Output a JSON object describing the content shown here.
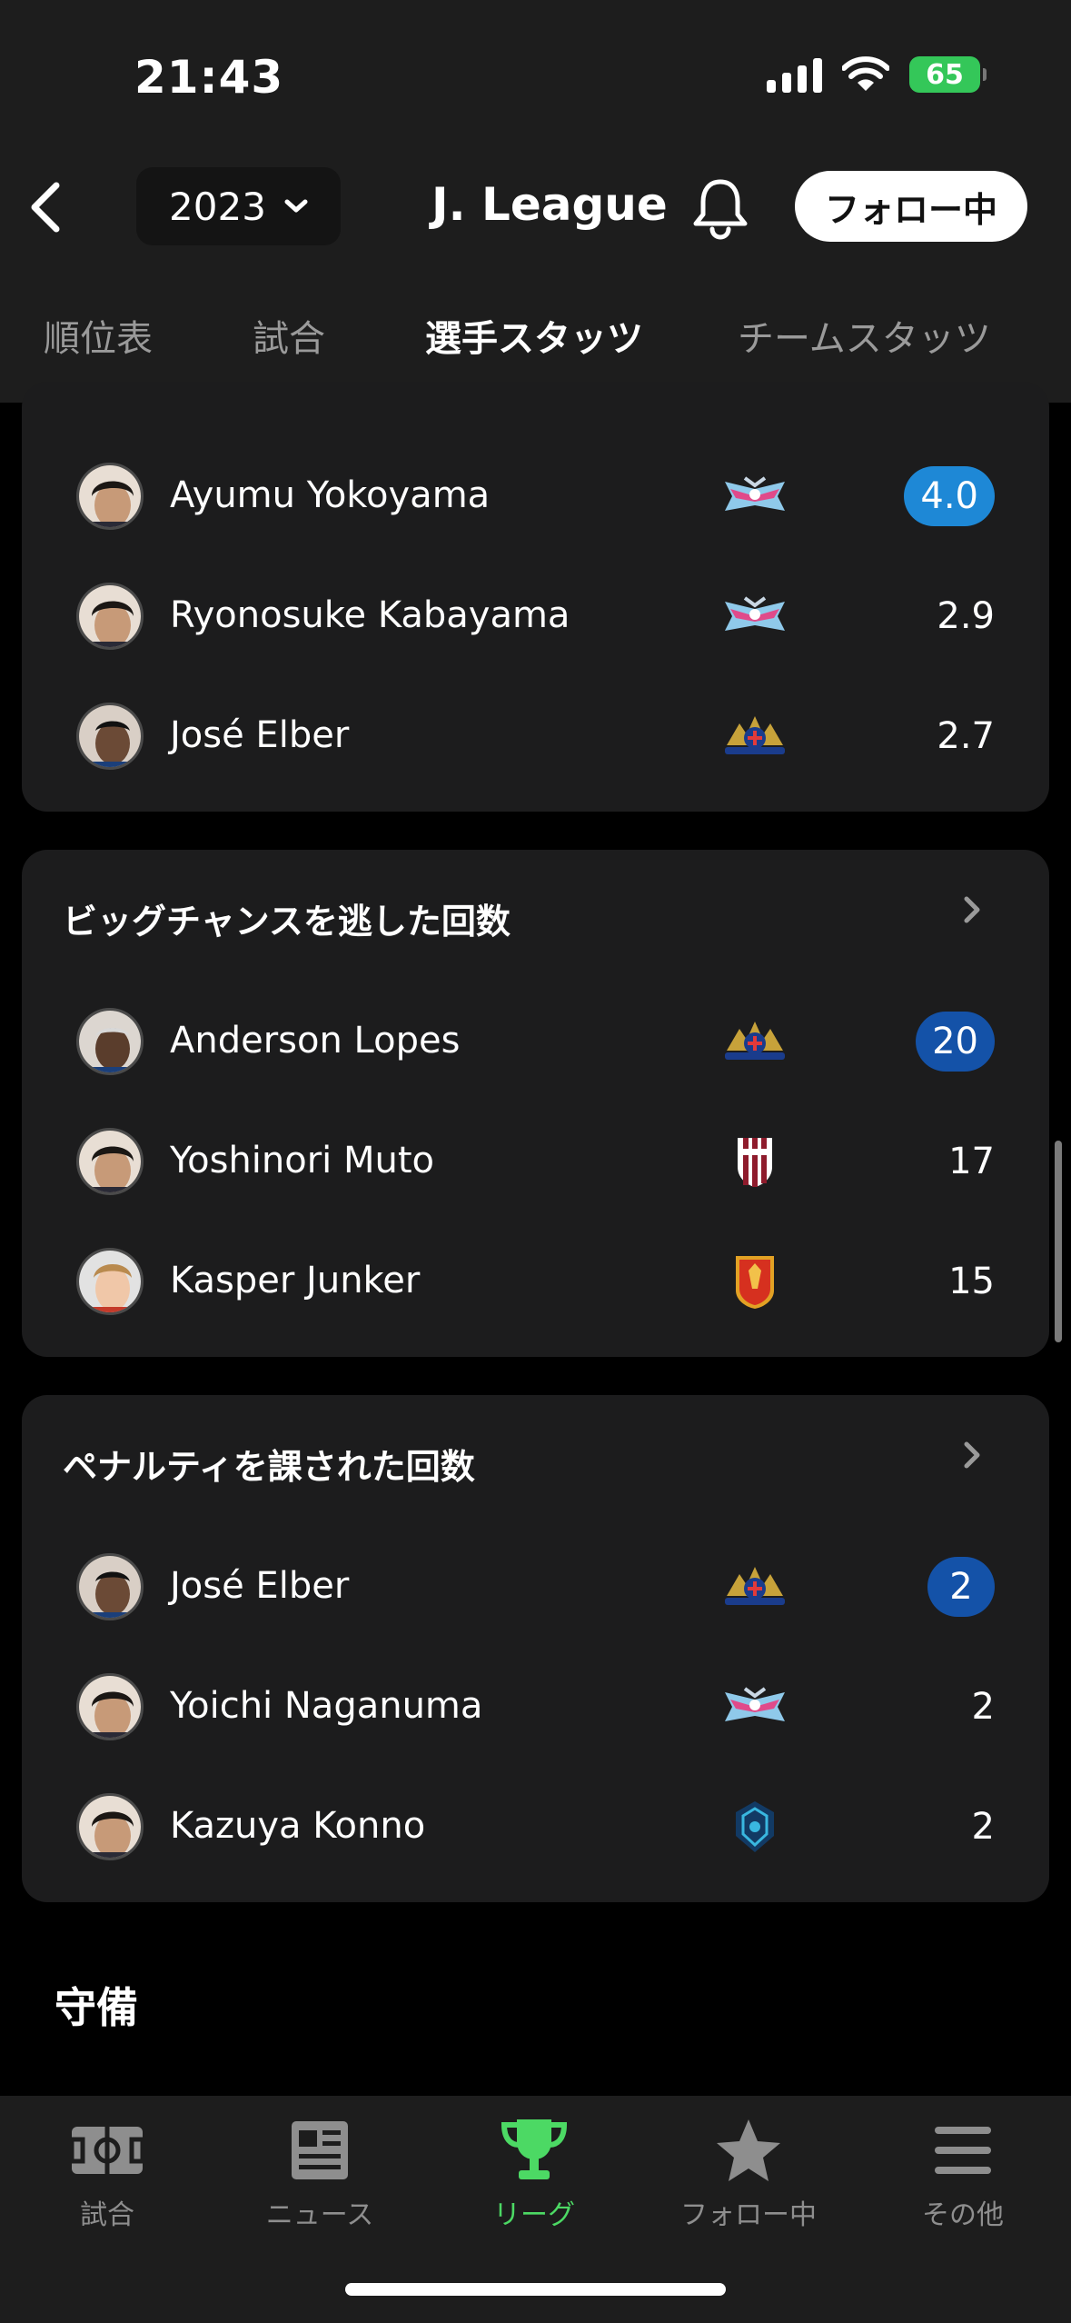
{
  "status_bar": {
    "time": "21:43",
    "battery": "65"
  },
  "header": {
    "year": "2023",
    "title": "J. League",
    "follow_label": "フォロー中"
  },
  "tabs": [
    {
      "label": "順位表"
    },
    {
      "label": "試合"
    },
    {
      "label": "選手スタッツ"
    },
    {
      "label": "チームスタッツ"
    }
  ],
  "accent_color": "#4cd964",
  "cards": [
    {
      "title": "",
      "rows": [
        {
          "name": "Ayumu Yokoyama",
          "team": "sagan-tosu-logo",
          "value": "4.0",
          "badge_color": "#1e88d6"
        },
        {
          "name": "Ryonosuke Kabayama",
          "team": "sagan-tosu-logo",
          "value": "2.9"
        },
        {
          "name": "José Elber",
          "team": "yokohama-f-marinos-logo",
          "value": "2.7"
        }
      ]
    },
    {
      "title": "ビッグチャンスを逃した回数",
      "rows": [
        {
          "name": "Anderson Lopes",
          "team": "yokohama-f-marinos-logo",
          "value": "20",
          "badge_color": "#1452a8"
        },
        {
          "name": "Yoshinori Muto",
          "team": "vissel-kobe-logo",
          "value": "17"
        },
        {
          "name": "Kasper Junker",
          "team": "nagoya-grampus-logo",
          "value": "15"
        }
      ]
    },
    {
      "title": "ペナルティを課された回数",
      "rows": [
        {
          "name": "José Elber",
          "team": "yokohama-f-marinos-logo",
          "value": "2",
          "badge_color": "#1452a8"
        },
        {
          "name": "Yoichi Naganuma",
          "team": "sagan-tosu-logo",
          "value": "2"
        },
        {
          "name": "Kazuya Konno",
          "team": "avispa-fukuoka-logo",
          "value": "2"
        }
      ]
    }
  ],
  "section": {
    "title": "守備"
  },
  "bottom_nav": [
    {
      "label": "試合",
      "icon": "pitch-icon"
    },
    {
      "label": "ニュース",
      "icon": "newspaper-icon"
    },
    {
      "label": "リーグ",
      "icon": "trophy-icon"
    },
    {
      "label": "フォロー中",
      "icon": "star-icon"
    },
    {
      "label": "その他",
      "icon": "menu-icon"
    }
  ]
}
